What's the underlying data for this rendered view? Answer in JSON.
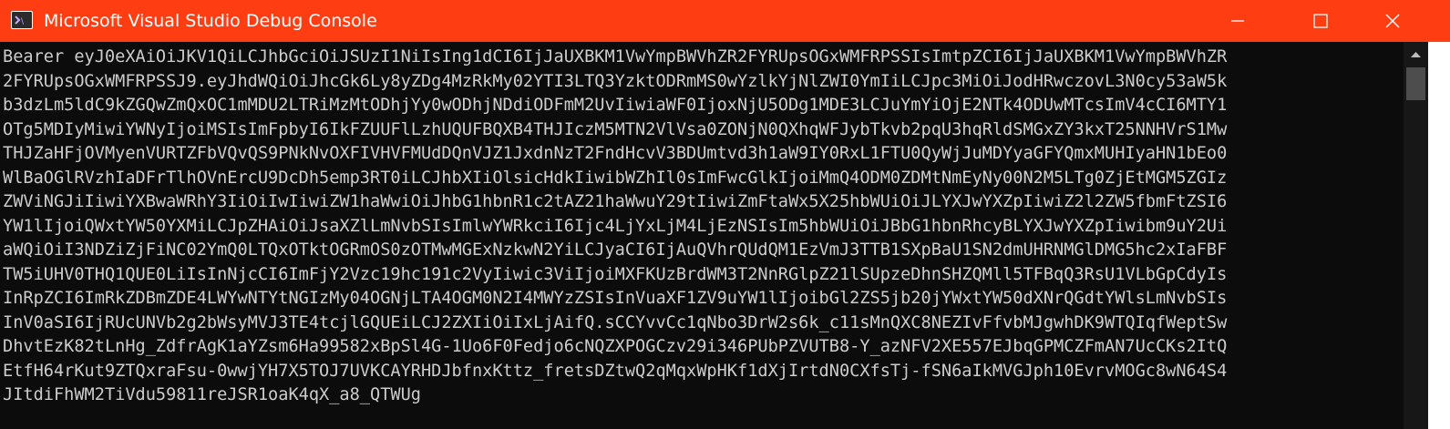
{
  "window": {
    "title": "Microsoft Visual Studio Debug Console",
    "icon": "console-app-icon",
    "titlebar_color": "#ff3d12"
  },
  "controls": {
    "minimize_icon": "minimize-icon",
    "maximize_icon": "maximize-icon",
    "close_icon": "close-icon"
  },
  "console": {
    "background": "#0c0c0c",
    "text_color": "#cccccc",
    "lines": [
      "Bearer eyJ0eXAiOiJKV1QiLCJhbGciOiJSUzI1NiIsIng1dCI6IjJaUXBKM1VwYmpBWVhZR2FYRUpsOGxWMFRPSSIsImtpZCI6IjJaUXBKM1VwYmpBWVhZR",
      "2FYRUpsOGxWMFRPSSJ9.eyJhdWQiOiJhcGk6Ly8yZDg4MzRkMy02YTI3LTQ3YzktODRmMS0wYzlkYjNlZWI0YmIiLCJpc3MiOiJodHRwczovL3N0cy53aW5k",
      "b3dzLm5ldC9kZGQwZmQxOC1mMDU2LTRiMzMtODhjYy0wODhjNDdiODFmM2UvIiwiaWF0IjoxNjU5ODg1MDE3LCJuYmYiOjE2NTk4ODUwMTcsImV4cCI6MTY1",
      "OTg5MDIyMiwiYWNyIjoiMSIsImFpbyI6IkFZUUFlLzhUQUFBQXB4THJIczM5MTN2VlVsa0ZONjN0QXhqWFJybTkvb2pqU3hqRldSMGxZY3kxT25NNHVrS1Mw",
      "THJZaHFjOVMyenVURTZFbVQvQS9PNkNvOXFIVHVFMUdDQnVJZ1JxdnNzT2FndHcvV3BDUmtvd3h1aW9IY0RxL1FTU0QyWjJuMDYyaGFYQmxMUHIyaHN1bEo0",
      "WlBaOGlRVzhIaDFrTlhOVnErcU9DcDh5emp3RT0iLCJhbXIiOlsicHdkIiwibWZhIl0sImFwcGlkIjoiMmQ4ODM0ZDMtNmEyNy00N2M5LTg0ZjEtMGM5ZGIz",
      "ZWViNGJiIiwiYXBwaWRhY3IiOiIwIiwiZW1haWwiOiJhbG1hbnR1c2tAZ21haWwuY29tIiwiZmFtaWx5X25hbWUiOiJLYXJwYXZpIiwiZ2l2ZW5fbmFtZSI6",
      "YW1lIjoiQWxtYW50YXMiLCJpZHAiOiJsaXZlLmNvbSIsImlwYWRkciI6Ijc4LjYxLjM4LjEzNSIsIm5hbWUiOiJBbG1hbnRhcyBLYXJwYXZpIiwibm9uY2Ui",
      "aWQiOiI3NDZiZjFiNC02YmQ0LTQxOTktOGRmOS0zOTMwMGExNzkwN2YiLCJyaCI6IjAuQVhrQUdQM1EzVmJ3TTB1SXpBaU1SN2dmUHRNMGlDMG5hc2xIaFBF",
      "TW5iUHV0THQ1QUE0LiIsInNjcCI6ImFjY2Vzc19hc191c2VyIiwic3ViIjoiMXFKUzBrdWM3T2NnRGlpZ21lSUpzeDhnSHZQMll5TFBqQ3RsU1VLbGpCdyIs",
      "InRpZCI6ImRkZDBmZDE4LWYwNTYtNGIzMy04OGNjLTA4OGM0N2I4MWYzZSIsInVuaXF1ZV9uYW1lIjoibGl2ZS5jb20jYWxtYW50dXNrQGdtYWlsLmNvbSIs",
      "InV0aSI6IjRUcUNVb2g2bWsyMVJ3TE4tcjlGQUEiLCJ2ZXIiOiIxLjAifQ.sCCYvvCc1qNbo3DrW2s6k_c11sMnQXC8NEZIvFfvbMJgwhDK9WTQIqfWeptSw",
      "DhvtEzK82tLnHg_ZdfrAgK1aYZsm6Ha99582xBpSl4G-1Uo6F0Fedjo6cNQZXPOGCzv29i346PUbPZVUTB8-Y_azNFV2XE557EJbqGPMCZFmAN7UcCKs2ItQ",
      "EtfH64rKut9ZTQxraFsu-0wwjYH7X5TOJ7UVKCAYRHDJbfnxKttz_fretsDZtwQ2qMqxWpHKf1dXjIrtdN0CXfsTj-fSN6aIkMVGJph10EvrvMOGc8wN64S4",
      "JItdiFhWM2TiVdu59811reJSR1oaK4qX_a8_QTWUg"
    ]
  }
}
